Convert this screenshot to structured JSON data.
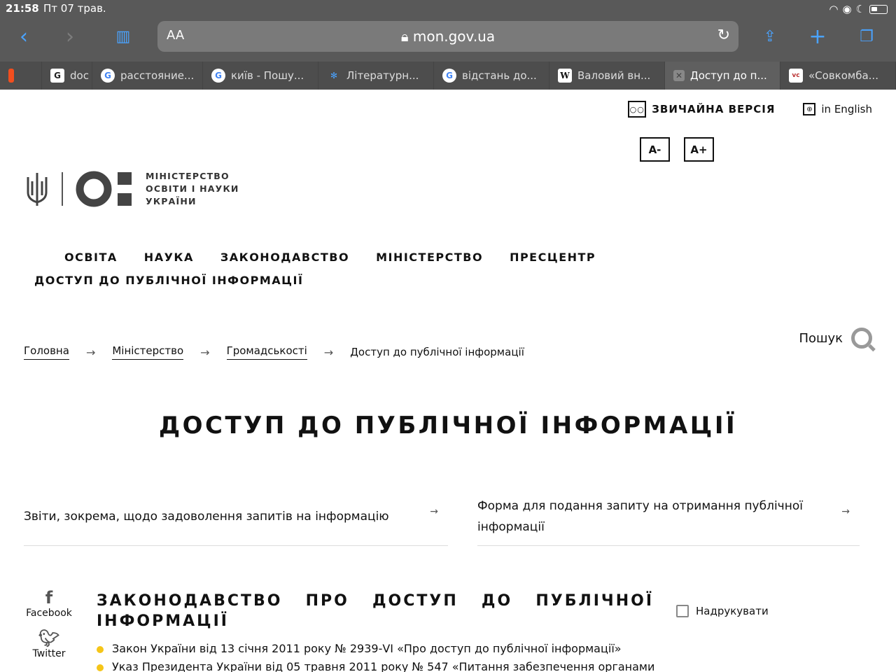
{
  "status": {
    "time": "21:58",
    "date": "Пт 07 трав."
  },
  "browser": {
    "aa": "AA",
    "url": "mon.gov.ua",
    "tabs": [
      {
        "label": "doc",
        "icon": "docs-icon"
      },
      {
        "label": "расстояние...",
        "icon": "google-icon"
      },
      {
        "label": "київ - Пошу...",
        "icon": "google-icon"
      },
      {
        "label": "Літературн...",
        "icon": "star-icon"
      },
      {
        "label": "відстань до...",
        "icon": "google-icon"
      },
      {
        "label": "Валовий вн...",
        "icon": "wikipedia-icon"
      },
      {
        "label": "Доступ до п...",
        "icon": "close-icon"
      },
      {
        "label": "«Совкомба...",
        "icon": "vc-icon"
      }
    ]
  },
  "header": {
    "version_link": "ЗВИЧАЙНА ВЕРСІЯ",
    "english_link": "in English",
    "font_minus": "A-",
    "font_plus": "A+",
    "logo_line1": "МІНІСТЕРСТВО",
    "logo_line2": "ОСВІТИ І НАУКИ",
    "logo_line3": "УКРАЇНИ"
  },
  "nav": {
    "items": [
      "ОСВІТА",
      "НАУКА",
      "ЗАКОНОДАВСТВО",
      "МІНІСТЕРСТВО",
      "ПРЕСЦЕНТР"
    ],
    "second_row": "ДОСТУП ДО ПУБЛІЧНОЇ ІНФОРМАЦІЇ"
  },
  "breadcrumb": {
    "items": [
      "Головна",
      "Міністерство",
      "Громадськості"
    ],
    "current": "Доступ до публічної інформації"
  },
  "search": {
    "label": "Пошук"
  },
  "page_title": "ДОСТУП ДО ПУБЛІЧНОЇ ІНФОРМАЦІЇ",
  "cards": [
    "Звіти, зокрема, щодо задоволення запитів на інформацію",
    "Форма для подання запиту на отримання публічної інформації"
  ],
  "social": {
    "facebook": "Facebook",
    "twitter": "Twitter"
  },
  "law": {
    "title": "ЗАКОНОДАВСТВО ПРО ДОСТУП ДО ПУБЛІЧНОЇ ІНФОРМАЦІЇ",
    "items": [
      "Закон України від 13 січня 2011 року № 2939-VI «Про доступ до публічної інформації»",
      "Указ Президента України від 05 травня 2011 року № 547 «Питання забезпечення органами"
    ]
  },
  "print": "Надрукувати"
}
